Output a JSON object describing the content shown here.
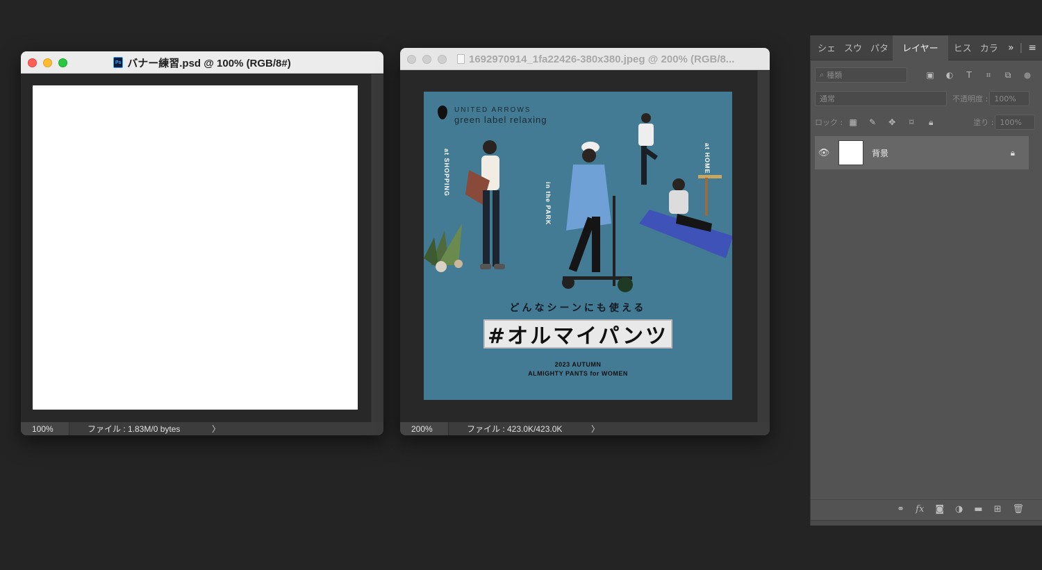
{
  "window1": {
    "title": "バナー練習.psd @ 100% (RGB/8#)",
    "app_icon": "Ps",
    "zoom": "100%",
    "file_info": "ファイル : 1.83M/0 bytes",
    "chevron": "〉"
  },
  "window2": {
    "title": "1692970914_1fa22426-380x380.jpeg @ 200% (RGB/8...",
    "zoom": "200%",
    "file_info": "ファイル : 423.0K/423.0K",
    "chevron": "〉",
    "banner": {
      "bg_color": "#437b95",
      "brand_line1": "UNITED ARROWS",
      "brand_line2": "green label relaxing",
      "label_shopping": "at SHOPPING",
      "label_park": "in the PARK",
      "label_home": "at HOME",
      "subcopy": "どんなシーンにも使える",
      "headline": "#オルマイパンツ",
      "season_line1": "2023 AUTUMN",
      "season_line2": "ALMIGHTY PANTS for WOMEN"
    }
  },
  "panel": {
    "tabs": [
      "シェ",
      "スウ",
      "パタ",
      "レイヤー",
      "ヒス",
      "カラ"
    ],
    "active_tab": "レイヤー",
    "more_icon": "»",
    "search_placeholder": "種類",
    "blend_mode": "通常",
    "opacity_label": "不透明度 :",
    "opacity_value": "100%",
    "lock_label": "ロック :",
    "fill_label": "塗り :",
    "fill_value": "100%",
    "layers": [
      {
        "name": "背景",
        "visible": true,
        "locked": true
      }
    ]
  }
}
